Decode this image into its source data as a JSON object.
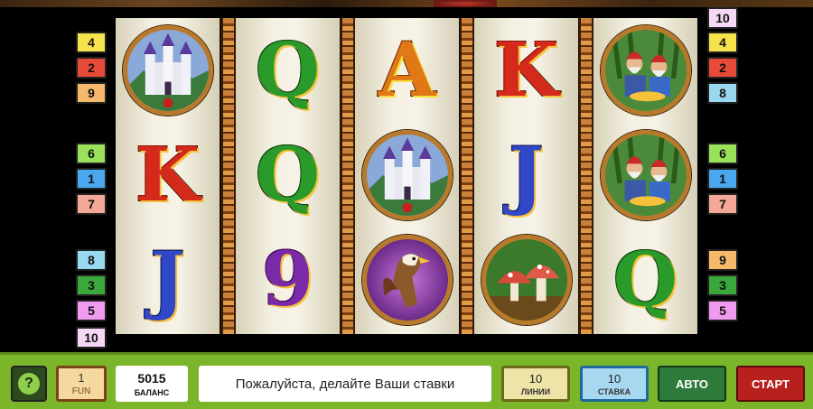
{
  "reels": [
    [
      {
        "kind": "castle",
        "icon": "castle-icon"
      },
      {
        "kind": "letter",
        "text": "K",
        "color": "#d42a1c"
      },
      {
        "kind": "letter",
        "text": "J",
        "color": "#3048c8"
      }
    ],
    [
      {
        "kind": "letter",
        "text": "Q",
        "color": "#2a9a2a"
      },
      {
        "kind": "letter",
        "text": "Q",
        "color": "#2a9a2a"
      },
      {
        "kind": "letter",
        "text": "9",
        "color": "#7a2aa8"
      }
    ],
    [
      {
        "kind": "letter",
        "text": "A",
        "color": "#e07818"
      },
      {
        "kind": "castle",
        "icon": "castle-icon"
      },
      {
        "kind": "griffin",
        "icon": "griffin-icon"
      }
    ],
    [
      {
        "kind": "letter",
        "text": "K",
        "color": "#d42a1c"
      },
      {
        "kind": "letter",
        "text": "J",
        "color": "#3048c8"
      },
      {
        "kind": "mushroom",
        "icon": "mushroom-icon"
      }
    ],
    [
      {
        "kind": "gnomes",
        "icon": "gnomes-icon"
      },
      {
        "kind": "gnomes",
        "icon": "gnomes-icon"
      },
      {
        "kind": "letter",
        "text": "Q",
        "color": "#2a9a2a"
      }
    ]
  ],
  "left_markers": [
    {
      "num": "4",
      "color": "#f6e24a"
    },
    {
      "num": "2",
      "color": "#e84a3a"
    },
    {
      "num": "9",
      "color": "#f6b86a"
    },
    {
      "num": "6",
      "color": "#9ae25a"
    },
    {
      "num": "1",
      "color": "#4aa8f0"
    },
    {
      "num": "7",
      "color": "#f6a898"
    },
    {
      "num": "8",
      "color": "#9ad8f0"
    },
    {
      "num": "3",
      "color": "#3aa83a"
    },
    {
      "num": "5",
      "color": "#f09af0"
    },
    {
      "num": "10",
      "color": "#f6d8f6"
    }
  ],
  "right_markers": [
    {
      "num": "10",
      "color": "#f6d8f6"
    },
    {
      "num": "4",
      "color": "#f6e24a"
    },
    {
      "num": "2",
      "color": "#e84a3a"
    },
    {
      "num": "8",
      "color": "#9ad8f0"
    },
    {
      "num": "6",
      "color": "#9ae25a"
    },
    {
      "num": "1",
      "color": "#4aa8f0"
    },
    {
      "num": "7",
      "color": "#f6a898"
    },
    {
      "num": "9",
      "color": "#f6b86a"
    },
    {
      "num": "3",
      "color": "#3aa83a"
    },
    {
      "num": "5",
      "color": "#f09af0"
    }
  ],
  "controls": {
    "help_label": "?",
    "fun_value": "1",
    "fun_label": "FUN",
    "balance_value": "5015",
    "balance_label": "БАЛАНС",
    "message": "Пожалуйста, делайте Ваши ставки",
    "lines_value": "10",
    "lines_label": "ЛИНИИ",
    "bet_value": "10",
    "bet_label": "СТАВКА",
    "auto_label": "АВТО",
    "start_label": "СТАРТ"
  }
}
